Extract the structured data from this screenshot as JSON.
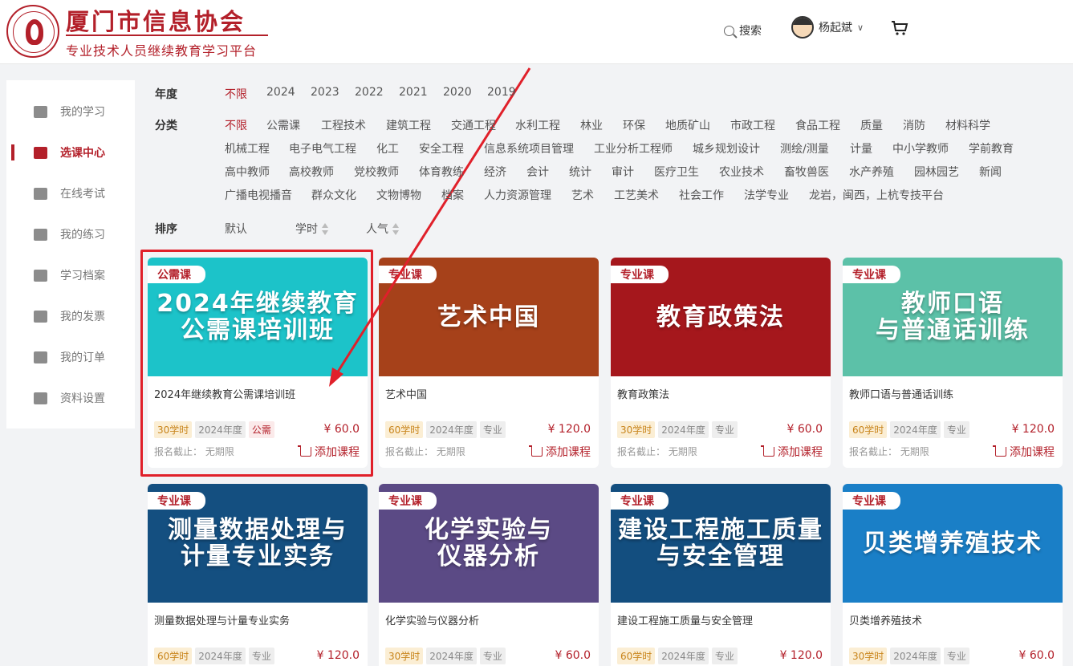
{
  "header": {
    "title": "厦门市信息协会",
    "subtitle": "专业技术人员继续教育学习平台",
    "search_label": "搜索",
    "user_name": "杨起斌"
  },
  "sidebar": {
    "items": [
      {
        "label": "我的学习",
        "icon": "graduation-cap-icon",
        "active": false
      },
      {
        "label": "选课中心",
        "icon": "course-list-icon",
        "active": true
      },
      {
        "label": "在线考试",
        "icon": "pen-paper-icon",
        "active": false
      },
      {
        "label": "我的练习",
        "icon": "book-icon",
        "active": false
      },
      {
        "label": "学习档案",
        "icon": "archive-icon",
        "active": false
      },
      {
        "label": "我的发票",
        "icon": "invoice-icon",
        "active": false
      },
      {
        "label": "我的订单",
        "icon": "clipboard-icon",
        "active": false
      },
      {
        "label": "资料设置",
        "icon": "gear-icon",
        "active": false
      }
    ]
  },
  "filters": {
    "year_label": "年度",
    "years": [
      "不限",
      "2024",
      "2023",
      "2022",
      "2021",
      "2020",
      "2019"
    ],
    "category_label": "分类",
    "categories": [
      [
        "不限",
        "公需课",
        "工程技术",
        "建筑工程",
        "交通工程",
        "水利工程",
        "林业",
        "环保",
        "地质矿山",
        "市政工程",
        "食品工程",
        "质量",
        "消防",
        "材料科学"
      ],
      [
        "机械工程",
        "电子电气工程",
        "化工",
        "安全工程",
        "信息系统项目管理",
        "工业分析工程师",
        "城乡规划设计",
        "测绘/测量",
        "计量",
        "中小学教师",
        "学前教育"
      ],
      [
        "高中教师",
        "高校教师",
        "党校教师",
        "体育教练",
        "经济",
        "会计",
        "统计",
        "审计",
        "医疗卫生",
        "农业技术",
        "畜牧兽医",
        "水产养殖",
        "园林园艺",
        "新闻"
      ],
      [
        "广播电视播音",
        "群众文化",
        "文物博物",
        "档案",
        "人力资源管理",
        "艺术",
        "工艺美术",
        "社会工作",
        "法学专业",
        "龙岩，闽西，上杭专技平台"
      ]
    ],
    "sort_label": "排序",
    "sort_options": [
      "默认",
      "学时",
      "人气"
    ]
  },
  "common": {
    "deadline_label": "报名截止：",
    "deadline_value": "无期限",
    "add_label": "添加课程"
  },
  "courses": [
    {
      "tag": "公需课",
      "banner": "2024年继续教育\n公需课培训班",
      "title": "2024年继续教育公需课培训班",
      "hours": "30学时",
      "year": "2024年度",
      "type": "公需",
      "price": "¥ 60.0",
      "bg": "#1cc3c9"
    },
    {
      "tag": "专业课",
      "banner": "艺术中国",
      "title": "艺术中国",
      "hours": "60学时",
      "year": "2024年度",
      "type": "专业",
      "price": "¥ 120.0",
      "bg": "#a6411a"
    },
    {
      "tag": "专业课",
      "banner": "教育政策法",
      "title": "教育政策法",
      "hours": "30学时",
      "year": "2024年度",
      "type": "专业",
      "price": "¥ 60.0",
      "bg": "#a5171c"
    },
    {
      "tag": "专业课",
      "banner": "教师口语\n与普通话训练",
      "title": "教师口语与普通话训练",
      "hours": "60学时",
      "year": "2024年度",
      "type": "专业",
      "price": "¥ 120.0",
      "bg": "#5cc1a8"
    },
    {
      "tag": "专业课",
      "banner": "测量数据处理与\n计量专业实务",
      "title": "测量数据处理与计量专业实务",
      "hours": "60学时",
      "year": "2024年度",
      "type": "专业",
      "price": "¥ 120.0",
      "bg": "#144f80"
    },
    {
      "tag": "专业课",
      "banner": "化学实验与\n仪器分析",
      "title": "化学实验与仪器分析",
      "hours": "30学时",
      "year": "2024年度",
      "type": "专业",
      "price": "¥ 60.0",
      "bg": "#5b4a85"
    },
    {
      "tag": "专业课",
      "banner": "建设工程施工质量\n与安全管理",
      "title": "建设工程施工质量与安全管理",
      "hours": "60学时",
      "year": "2024年度",
      "type": "专业",
      "price": "¥ 120.0",
      "bg": "#134e7f"
    },
    {
      "tag": "专业课",
      "banner": "贝类增养殖技术",
      "title": "贝类增养殖技术",
      "hours": "30学时",
      "year": "2024年度",
      "type": "专业",
      "price": "¥ 60.0",
      "bg": "#1a7fc7"
    }
  ]
}
